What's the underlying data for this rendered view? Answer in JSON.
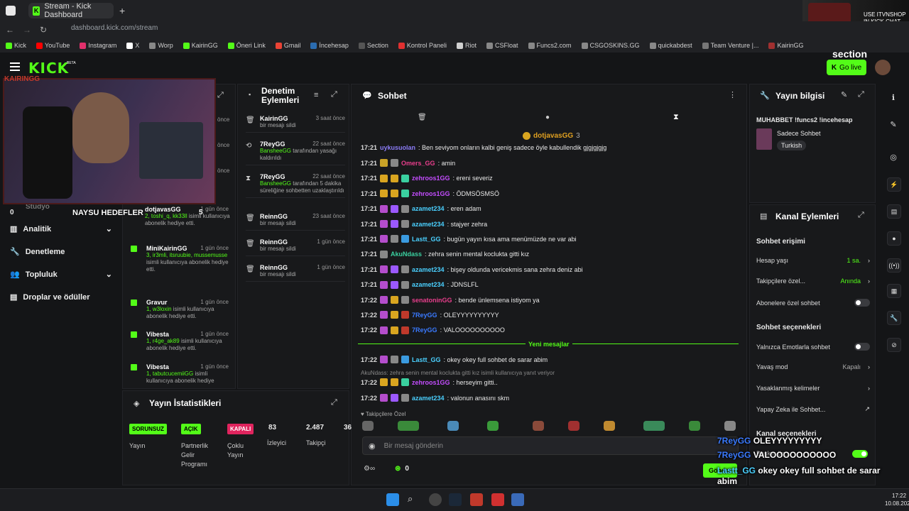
{
  "browser": {
    "tab_title": "Stream - Kick Dashboard",
    "url": "dashboard.kick.com/stream",
    "bookmarks": [
      "Kick",
      "YouTube",
      "Instagram",
      "X",
      "Worp",
      "KairinGG",
      "Öneri Link",
      "Gmail",
      "İncehesap",
      "Section",
      "Kontrol Paneli",
      "Riot",
      "CSFloat",
      "Funcs2.com",
      "CSGOSKINS.GG",
      "quickabdest",
      "Team Venture |...",
      "KairinGG"
    ],
    "ad_text": "USE ITVNSHOP\nIN KICK CHAT"
  },
  "header": {
    "logo": "KICK",
    "beta": "BETA",
    "go_live": "Go live",
    "sponsor": "section"
  },
  "webcam": {
    "name": "KAIRINGG",
    "goals_label": "NAYSU HEDEFLER",
    "goal_left": "0",
    "goal_right": "5"
  },
  "sidebar": {
    "items": [
      {
        "label": "Analitik"
      },
      {
        "label": "Denetleme"
      },
      {
        "label": "Topluluk"
      },
      {
        "label": "Droplar ve ödüller"
      }
    ],
    "partial": "Stüdyo",
    "partial_count": "0"
  },
  "events": {
    "items": [
      {
        "name": "dotjavasGG",
        "time": "1 gün önce",
        "desc_green": "2, toshi_q, kk33ll",
        "desc": "isimli kullanıcıya abonelik hediye etti."
      },
      {
        "name": "MiniKairinGG",
        "time": "1 gün önce",
        "desc_green": "3, ir3mli, itsruubie, mussemusse",
        "desc": "isimli kullanıcıya abonelik hediye etti."
      },
      {
        "name": "Gravur",
        "time": "1 gün önce",
        "desc_green": "1, w3loxin",
        "desc": "isimli kullanıcıya abonelik hediye etti."
      },
      {
        "name": "Vibesta",
        "time": "1 gün önce",
        "desc_green": "1, r4ge_ak89",
        "desc": "isimli kullanıcıya abonelik hediye etti."
      },
      {
        "name": "Vibesta",
        "time": "1 gün önce",
        "desc_green": "1, tabutcucemiiGG",
        "desc": "isimli kullanıcıya abonelik hediye"
      }
    ],
    "partial_times": [
      "önce",
      "önce",
      "önce"
    ]
  },
  "moderation": {
    "title": "Denetim Eylemleri",
    "items": [
      {
        "icon": "🗑",
        "name": "KairinGG",
        "time": "3 saat önce",
        "desc": "bir mesajı sildi"
      },
      {
        "icon": "⟲",
        "name": "7ReyGG",
        "time": "22 saat önce",
        "desc_green": "BansheeGG",
        "desc": "tarafından yasağı kaldırıldı"
      },
      {
        "icon": "⧗",
        "name": "7ReyGG",
        "time": "22 saat önce",
        "desc_green": "BansheeGG",
        "desc": "tarafından 5 dakika süreliğine sohbetten uzaklaştırıldı"
      },
      {
        "icon": "🗑",
        "name": "ReinnGG",
        "time": "23 saat önce",
        "desc": "bir mesajı sildi"
      },
      {
        "icon": "🗑",
        "name": "ReinnGG",
        "time": "1 gün önce",
        "desc": "bir mesajı sildi"
      },
      {
        "icon": "🗑",
        "name": "ReinnGG",
        "time": "1 gün önce",
        "desc": "bir mesajı sildi"
      }
    ]
  },
  "chat": {
    "title": "Sohbet",
    "pinned_user": "dotjavasGG",
    "pinned_count": "3",
    "messages": [
      {
        "time": "17:21",
        "user": "uykusuolan",
        "color": "#8b7cf7",
        "text": ": Ben seviyom onların kalbi geniş sadece öyle kabullendik gjgjgjgjg",
        "badges": []
      },
      {
        "time": "17:21",
        "user": "Omers_GG",
        "color": "#e83e8c",
        "text": ": amin",
        "badges": [
          "#c9a227",
          "#888"
        ]
      },
      {
        "time": "17:21",
        "user": "zehroos1GG",
        "color": "#c44dff",
        "text": ": ereni severiz",
        "badges": [
          "#d9a520",
          "#d9a520",
          "#3ad0a0"
        ]
      },
      {
        "time": "17:21",
        "user": "zehroos1GG",
        "color": "#c44dff",
        "text": ": ÖDMSÖSMSÖ",
        "badges": [
          "#d9a520",
          "#d9a520",
          "#3ad0a0"
        ]
      },
      {
        "time": "17:21",
        "user": "azamet234",
        "color": "#4ad0ff",
        "text": ": eren adam",
        "badges": [
          "#b44dcc",
          "#9b59ff",
          "#888"
        ]
      },
      {
        "time": "17:21",
        "user": "azamet234",
        "color": "#4ad0ff",
        "text": ": stajyer zehra",
        "badges": [
          "#b44dcc",
          "#9b59ff",
          "#888"
        ]
      },
      {
        "time": "17:21",
        "user": "Lastt_GG",
        "color": "#4ad0ff",
        "text": ": bugün yayın kısa ama menümüzde ne var abi",
        "badges": [
          "#b44dcc",
          "#888",
          "#3a9adf"
        ]
      },
      {
        "time": "17:21",
        "user": "AkuNdass",
        "color": "#3ad0a0",
        "text": ": zehra senin mental koclukta gitti kız",
        "badges": [
          "#888"
        ]
      },
      {
        "time": "17:21",
        "user": "azamet234",
        "color": "#4ad0ff",
        "text": ": bişey oldunda vericekmis sana zehra deniz abi",
        "badges": [
          "#b44dcc",
          "#9b59ff",
          "#888"
        ]
      },
      {
        "time": "17:21",
        "user": "azamet234",
        "color": "#4ad0ff",
        "text": ": JDNSLFL",
        "badges": [
          "#b44dcc",
          "#9b59ff",
          "#888"
        ]
      },
      {
        "time": "17:22",
        "user": "senatoninGG",
        "color": "#e83e8c",
        "text": ": bende ünlemsena istiyom ya",
        "badges": [
          "#b44dcc",
          "#d9a520",
          "#888"
        ]
      },
      {
        "time": "17:22",
        "user": "7ReyGG",
        "color": "#3a7aff",
        "text": ": OLEYYYYYYYYYY",
        "badges": [
          "#b44dcc",
          "#d9a520",
          "#c0392b"
        ]
      },
      {
        "time": "17:22",
        "user": "7ReyGG",
        "color": "#3a7aff",
        "text": ": VALOOOOOOOOOO",
        "badges": [
          "#b44dcc",
          "#d9a520",
          "#c0392b"
        ]
      }
    ],
    "new_messages": "Yeni mesajlar",
    "after": [
      {
        "time": "17:22",
        "user": "Lastt_GG",
        "color": "#4ad0ff",
        "text": ": okey okey full sohbet de sarar abim",
        "badges": [
          "#b44dcc",
          "#888",
          "#3a9adf"
        ]
      },
      {
        "time": "17:22",
        "user": "zehroos1GG",
        "color": "#c44dff",
        "text": ": herseyim gitti..",
        "badges": [
          "#d9a520",
          "#d9a520",
          "#3ad0a0"
        ]
      },
      {
        "time": "17:22",
        "user": "azamet234",
        "color": "#4ad0ff",
        "text": ": valonun anasını skm",
        "badges": [
          "#b44dcc",
          "#9b59ff",
          "#888"
        ]
      }
    ],
    "reply_preview": "AkuNdass: zehra senin mental koclukta gitti kız isimli kullanıcıya yanıt veriyor",
    "emote_label": "Takipçilere Özel",
    "input_placeholder": "Bir mesaj gönderin",
    "points": "0",
    "send_label": "Gönder"
  },
  "stream_info": {
    "title": "Yayın bilgisi",
    "stream_title": "MUHABBET !funcs2 !incehesap",
    "category": "Sadece Sohbet",
    "language": "Turkish"
  },
  "channel_actions": {
    "title": "Kanal Eylemleri",
    "chat_access": "Sohbet erişimi",
    "account_age_label": "Hesap yaşı",
    "account_age_value": "1 sa.",
    "followers_label": "Takipçilere özel...",
    "followers_value": "Anında",
    "subs_label": "Abonelere özel sohbet",
    "chat_options": "Sohbet seçenekleri",
    "emotes_label": "Yalnızca Emotlarla sohbet",
    "slow_label": "Yavaş mod",
    "slow_value": "Kapalı",
    "banned_label": "Yasaklanmış kelimeler",
    "ai_label": "Yapay Zeka ile Sohbet...",
    "channel_options": "Kanal seçenekleri",
    "partial_raid": "Baskın ön..."
  },
  "stats": {
    "title": "Yayın İstatistikleri",
    "tags": [
      {
        "label": "SORUNSUZ",
        "color": "#53fc18"
      },
      {
        "label": "AÇIK",
        "color": "#53fc18"
      },
      {
        "label": "KAPALI",
        "color": "#e0245e"
      }
    ],
    "labels": [
      "Yayın",
      "Partnerlik Gelir Programı",
      "Çoklu Yayın"
    ],
    "viewers": "83",
    "viewers_label": "İzleyici",
    "followers": "2.487",
    "followers_label": "Takipçi",
    "partial": "36"
  },
  "overlay": {
    "lines": [
      "7ReyGG OLEYYYYYYYYY",
      "7ReyGG VALOOOOOOOOOO",
      "Lastt_GG okey okey full sohbet de sarar abim",
      "azamet234 valonun anasını skm"
    ]
  },
  "taskbar": {
    "time": "17:22",
    "date": "10.08.2026"
  }
}
